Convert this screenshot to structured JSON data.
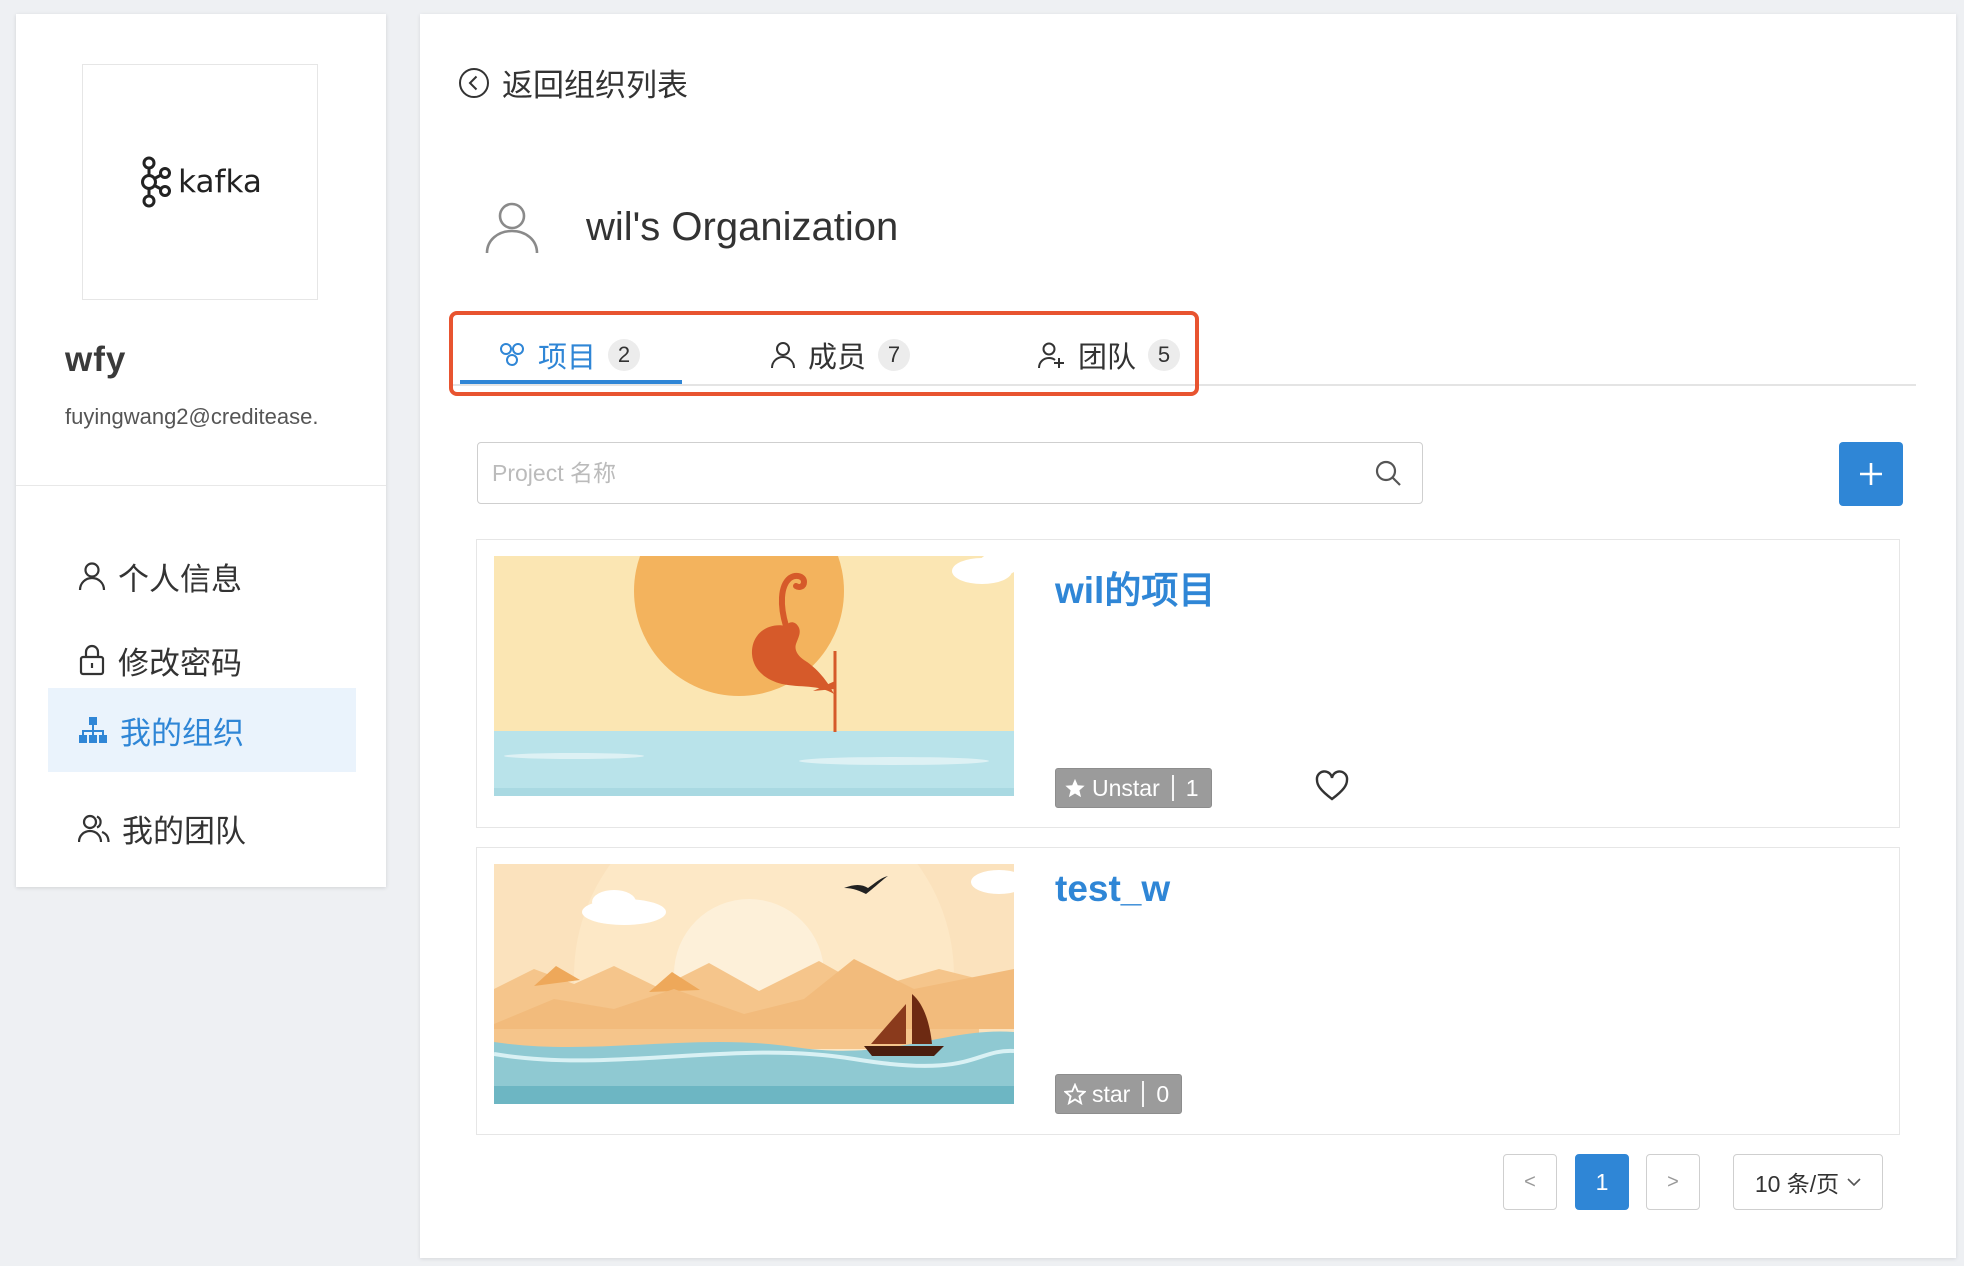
{
  "profile": {
    "logo_text": "kafka",
    "name": "wfy",
    "email": "fuyingwang2@creditease."
  },
  "sidebar": {
    "items": [
      {
        "label": "个人信息",
        "icon": "user-icon",
        "active": false
      },
      {
        "label": "修改密码",
        "icon": "lock-icon",
        "active": false
      },
      {
        "label": "我的组织",
        "icon": "org-chart-icon",
        "active": true
      },
      {
        "label": "我的团队",
        "icon": "team-icon",
        "active": false
      }
    ]
  },
  "header": {
    "back_label": "返回组织列表",
    "org_name": "wil's Organization"
  },
  "tabs": [
    {
      "label": "项目",
      "count": "2",
      "icon": "project-icon",
      "active": true
    },
    {
      "label": "成员",
      "count": "7",
      "icon": "member-icon",
      "active": false
    },
    {
      "label": "团队",
      "count": "5",
      "icon": "team-add-icon",
      "active": false
    }
  ],
  "search": {
    "placeholder": "Project 名称",
    "value": ""
  },
  "projects": [
    {
      "title": "wil的项目",
      "star_label": "Unstar",
      "star_count": "1",
      "starred": true
    },
    {
      "title": "test_w",
      "star_label": "star",
      "star_count": "0",
      "starred": false
    }
  ],
  "pagination": {
    "prev": "<",
    "current_page": "1",
    "next": ">",
    "page_size": "10 条/页"
  },
  "colors": {
    "accent": "#2f86d6",
    "highlight_box": "#e85430",
    "star_button": "#9b9b9b"
  }
}
